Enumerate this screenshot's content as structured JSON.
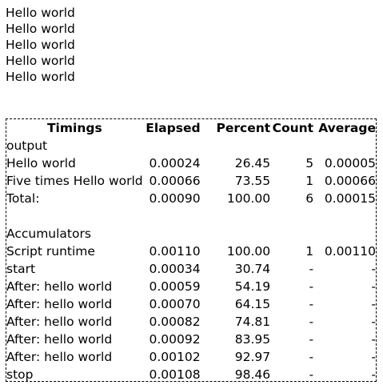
{
  "output_lines": [
    "Hello world",
    "Hello world",
    "Hello world",
    "Hello world",
    "Hello world"
  ],
  "table": {
    "headers": {
      "name": "Timings",
      "elapsed": "Elapsed",
      "percent": "Percent",
      "count": "Count",
      "average": "Average"
    },
    "output_section": {
      "title": "output",
      "rows": [
        {
          "name": "Hello world",
          "elapsed": "0.00024",
          "percent": "26.45",
          "count": "5",
          "average": "0.00005"
        },
        {
          "name": "Five times Hello world",
          "elapsed": "0.00066",
          "percent": "73.55",
          "count": "1",
          "average": "0.00066"
        }
      ],
      "total": {
        "name": "Total:",
        "elapsed": "0.00090",
        "percent": "100.00",
        "count": "6",
        "average": "0.00015"
      }
    },
    "accumulators_section": {
      "title": "Accumulators",
      "main": {
        "name": "Script runtime",
        "elapsed": "0.00110",
        "percent": "100.00",
        "count": "1",
        "average": "0.00110"
      },
      "rows": [
        {
          "name": "start",
          "elapsed": "0.00034",
          "percent": "30.74",
          "count": "-",
          "average": "-"
        },
        {
          "name": "After: hello world",
          "elapsed": "0.00059",
          "percent": "54.19",
          "count": "-",
          "average": "-"
        },
        {
          "name": "After: hello world",
          "elapsed": "0.00070",
          "percent": "64.15",
          "count": "-",
          "average": "-"
        },
        {
          "name": "After: hello world",
          "elapsed": "0.00082",
          "percent": "74.81",
          "count": "-",
          "average": "-"
        },
        {
          "name": "After: hello world",
          "elapsed": "0.00092",
          "percent": "83.95",
          "count": "-",
          "average": "-"
        },
        {
          "name": "After: hello world",
          "elapsed": "0.00102",
          "percent": "92.97",
          "count": "-",
          "average": "-"
        },
        {
          "name": "stop",
          "elapsed": "0.00108",
          "percent": "98.46",
          "count": "-",
          "average": "-"
        }
      ]
    }
  }
}
